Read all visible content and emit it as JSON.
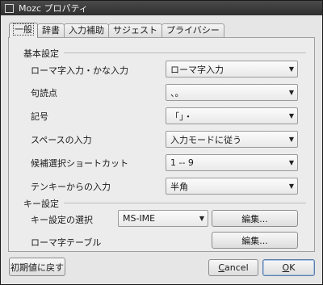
{
  "window": {
    "title": "Mozc プロパティ",
    "window_icon": "window-icon"
  },
  "tabs": [
    {
      "label": "一般"
    },
    {
      "label": "辞書"
    },
    {
      "label": "入力補助"
    },
    {
      "label": "サジェスト"
    },
    {
      "label": "プライバシー"
    }
  ],
  "basic": {
    "heading": "基本設定",
    "rows": [
      {
        "label": "ローマ字入力・かな入力",
        "value": "ローマ字入力"
      },
      {
        "label": "句読点",
        "value": "、。"
      },
      {
        "label": "記号",
        "value": "「」・"
      },
      {
        "label": "スペースの入力",
        "value": "入力モードに従う"
      },
      {
        "label": "候補選択ショートカット",
        "value": "1 -- 9"
      },
      {
        "label": "テンキーからの入力",
        "value": "半角"
      }
    ]
  },
  "keys": {
    "heading": "キー設定",
    "keymap_label": "キー設定の選択",
    "keymap_value": "MS-IME",
    "keymap_edit": "編集...",
    "romaji_label": "ローマ字テーブル",
    "romaji_edit": "編集..."
  },
  "footer": {
    "reset": "初期値に戻す",
    "cancel_first": "C",
    "cancel_rest": "ancel",
    "ok_first": "O",
    "ok_rest": "K"
  }
}
